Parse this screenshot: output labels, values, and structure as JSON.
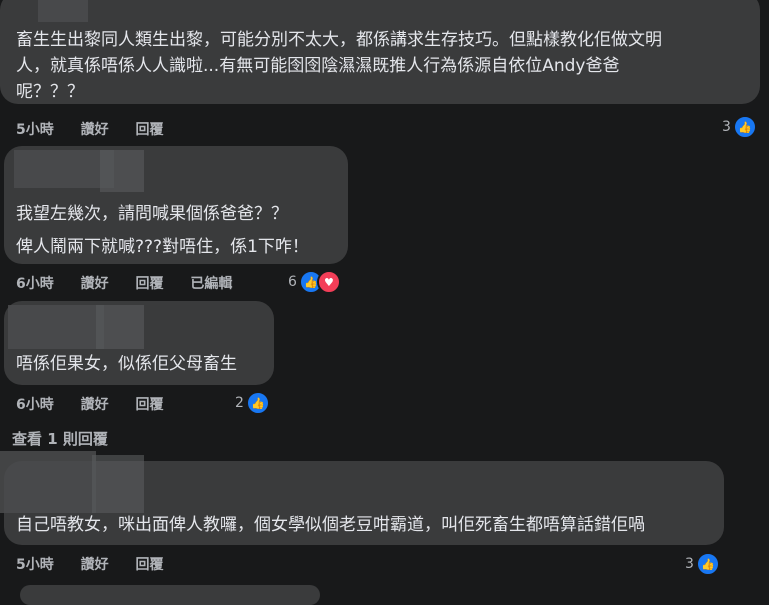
{
  "comments": [
    {
      "lines": [
        "畜生生出黎同人類生出黎，可能分別不太大，都係講求生存技巧。但點樣教化佢做文明",
        "人，就真係唔係人人識啦...有無可能囹囹陰濕濕既推人行為係源自依位Andy爸爸",
        "呢？？？"
      ],
      "time": "5小時",
      "like": "讚好",
      "reply": "回覆",
      "count": "3"
    },
    {
      "lines": [
        "我望左幾次，請問喊果個係爸爸？？",
        "俾人鬧兩下就喊???對唔住，係1下咋！"
      ],
      "time": "6小時",
      "like": "讚好",
      "reply": "回覆",
      "edited": "已編輯",
      "count": "6"
    },
    {
      "lines": [
        "唔係佢果女，似係佢父母畜生"
      ],
      "time": "6小時",
      "like": "讚好",
      "reply": "回覆",
      "count": "2"
    },
    {
      "lines": [
        "自己唔教女，咪出面俾人教囉，個女學似個老豆咁霸道，叫佢死畜生都唔算話錯佢喎"
      ],
      "time": "5小時",
      "like": "讚好",
      "reply": "回覆",
      "count": "3"
    }
  ],
  "view_replies": "查看 1 則回覆",
  "icons": {
    "like": "thumbs-up-icon",
    "love": "heart-icon"
  },
  "colors": {
    "like": "#1877f2",
    "love": "#f33e58",
    "bubble": "#3a3b3c"
  }
}
